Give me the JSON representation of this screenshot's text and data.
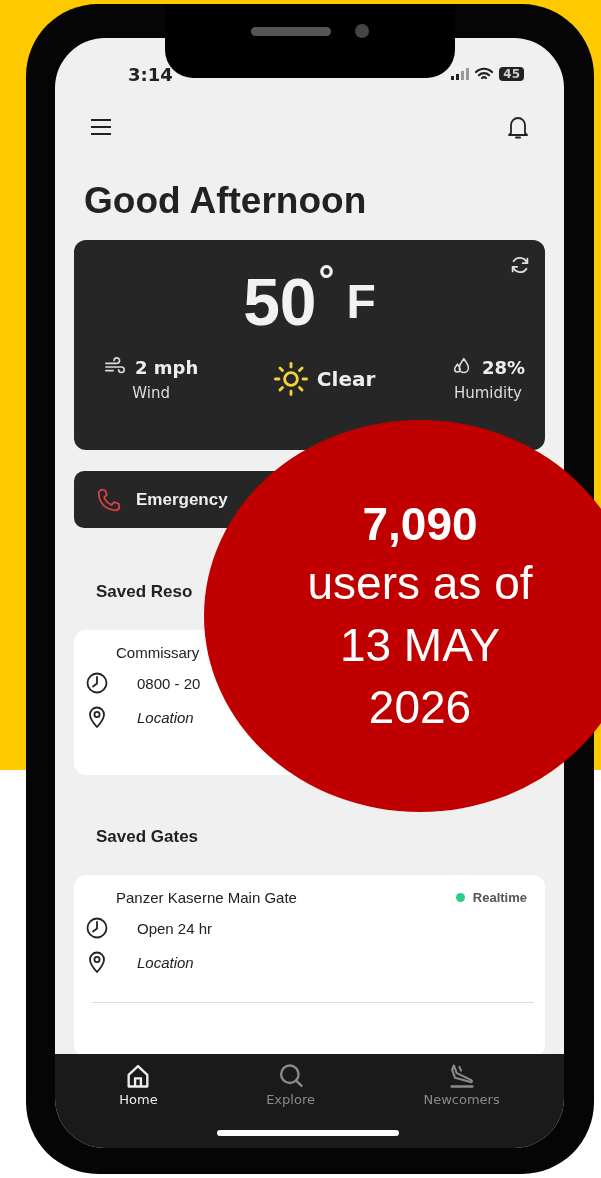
{
  "status_bar": {
    "time": "3:14",
    "battery": "45"
  },
  "greeting": "Good Afternoon",
  "weather": {
    "temperature": "50",
    "degree": "°",
    "unit": "F",
    "stats": [
      {
        "kind": "wind",
        "value": "2 mph",
        "label": "Wind"
      },
      {
        "kind": "condition",
        "value": "Clear"
      },
      {
        "kind": "humidity",
        "value": "28%",
        "label": "Humidity"
      }
    ]
  },
  "emergency_button": {
    "label": "Emergency"
  },
  "saved_resources": {
    "title": "Saved Reso",
    "cards": [
      {
        "name": "Commissary",
        "rows": [
          {
            "kind": "hours",
            "text": "0800 - 20"
          },
          {
            "kind": "location",
            "text": "Location"
          }
        ]
      }
    ]
  },
  "saved_gates": {
    "title": "Saved Gates",
    "cards": [
      {
        "name": "Panzer Kaserne Main Gate",
        "status": {
          "label": "Realtime",
          "color": "#2ecc8a"
        },
        "rows": [
          {
            "kind": "hours",
            "text": "Open 24 hr"
          },
          {
            "kind": "location",
            "text": "Location"
          }
        ]
      }
    ]
  },
  "tab_bar": [
    {
      "kind": "home",
      "label": "Home",
      "selected": true
    },
    {
      "kind": "explore",
      "label": "Explore",
      "selected": false
    },
    {
      "kind": "newcomers",
      "label": "Newcomers",
      "selected": false
    }
  ],
  "overlay_badge": {
    "count": "7,090",
    "lines": [
      "users as of",
      "13 MAY",
      "2026"
    ]
  }
}
